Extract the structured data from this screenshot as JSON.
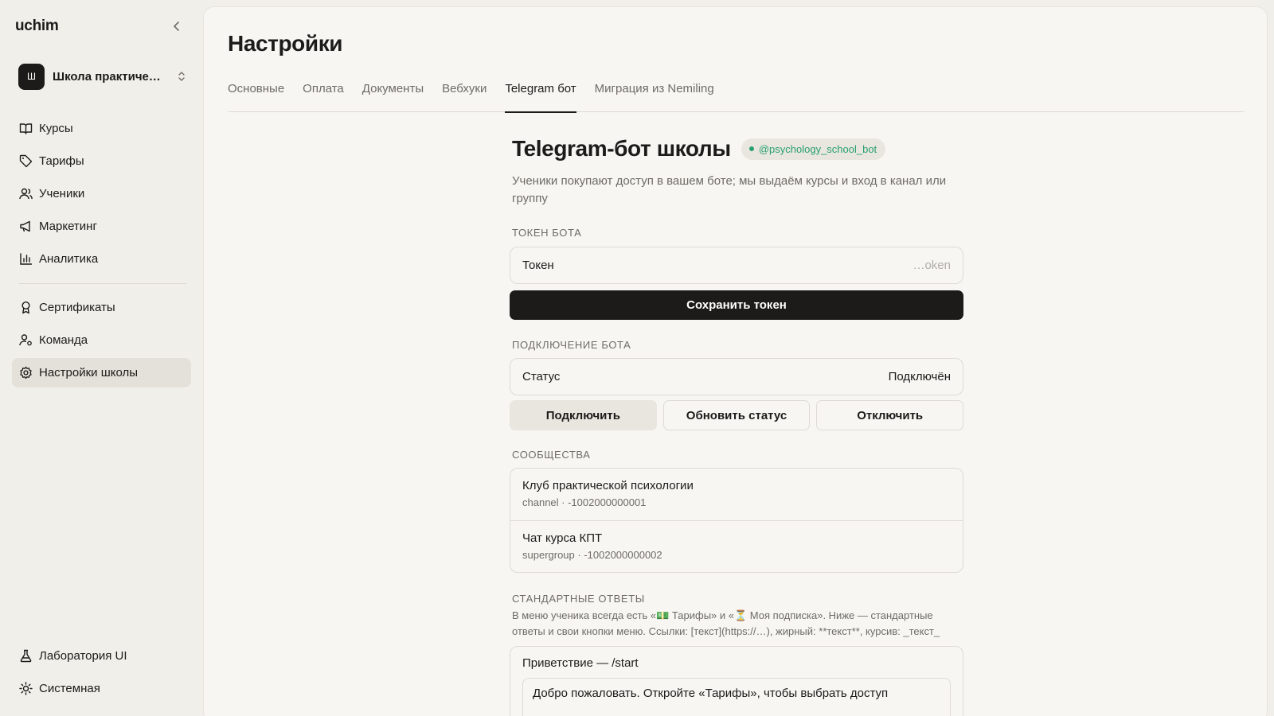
{
  "sidebar": {
    "logo": "uchim",
    "school": {
      "avatar": "Ш",
      "name": "Школа практической психологии"
    },
    "items": [
      {
        "label": "Курсы",
        "icon": "book-icon"
      },
      {
        "label": "Тарифы",
        "icon": "tag-icon"
      },
      {
        "label": "Ученики",
        "icon": "users-icon"
      },
      {
        "label": "Маркетинг",
        "icon": "megaphone-icon"
      },
      {
        "label": "Аналитика",
        "icon": "bar-chart-icon"
      },
      {
        "label": "Сертификаты",
        "icon": "award-icon"
      },
      {
        "label": "Команда",
        "icon": "user-cog-icon"
      },
      {
        "label": "Настройки школы",
        "icon": "gear-icon",
        "active": true
      }
    ],
    "bottom": [
      {
        "label": "Лаборатория UI",
        "icon": "flask-icon"
      },
      {
        "label": "Системная",
        "icon": "sun-icon"
      }
    ]
  },
  "page": {
    "title": "Настройки",
    "tabs": [
      "Основные",
      "Оплата",
      "Документы",
      "Вебхуки",
      "Telegram бот",
      "Миграция из Nemiling"
    ],
    "active_tab": "Telegram бот"
  },
  "bot": {
    "title": "Telegram-бот школы",
    "badge": "@psychology_school_bot",
    "description": "Ученики покупают доступ в вашем боте; мы выдаём курсы и вход в канал или группу",
    "token_section": "Токен бота",
    "token_label": "Токен",
    "token_placeholder": "…oken",
    "save_token": "Сохранить токен",
    "connection_section": "Подключение бота",
    "status_label": "Статус",
    "status_value": "Подключён",
    "connect": "Подключить",
    "refresh": "Обновить статус",
    "disconnect": "Отключить",
    "communities_section": "Сообщества",
    "communities": [
      {
        "title": "Клуб практической психологии",
        "sub": "channel · -1002000000001"
      },
      {
        "title": "Чат курса КПТ",
        "sub": "supergroup · -1002000000002"
      }
    ],
    "answers_section": "Стандартные ответы",
    "answers_hint": "В меню ученика всегда есть «💵 Тарифы» и «⏳ Моя подписка». Ниже — стандартные ответы и свои кнопки меню. Ссылки: [текст](https://…), жирный: **текст**, курсив: _текст_",
    "greeting_title": "Приветствие — /start",
    "greeting_text": "Добро пожаловать. Откройте «Тарифы», чтобы выбрать доступ"
  }
}
